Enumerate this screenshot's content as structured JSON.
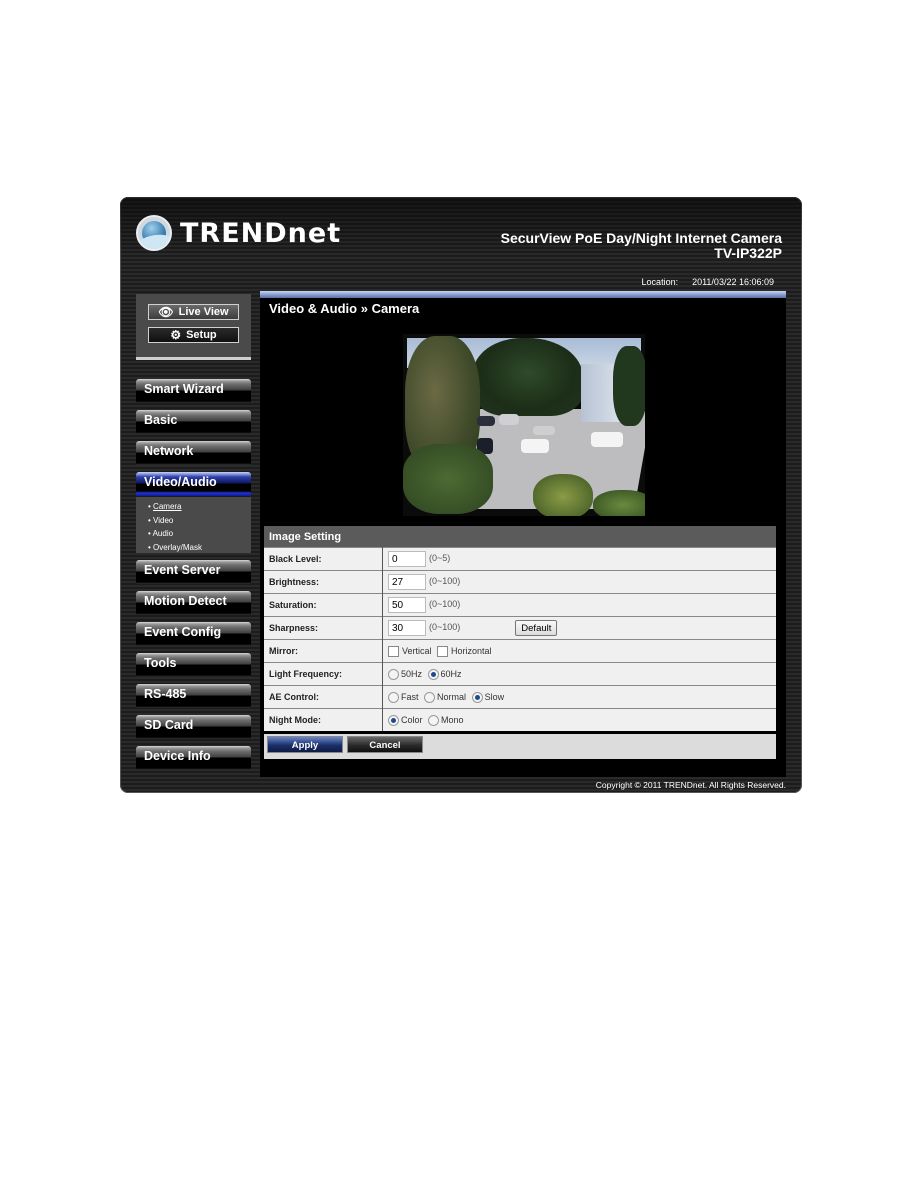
{
  "brand": {
    "logo_text": "TRENDnet"
  },
  "header": {
    "product_name": "SecurView PoE Day/Night Internet Camera",
    "model": "TV-IP322P",
    "location_label": "Location:",
    "datetime": "2011/03/22 16:06:09"
  },
  "mode_buttons": {
    "live_view": "Live View",
    "setup": "Setup"
  },
  "sidebar": {
    "items": [
      {
        "label": "Smart Wizard"
      },
      {
        "label": "Basic"
      },
      {
        "label": "Network"
      },
      {
        "label": "Video/Audio",
        "active": true
      },
      {
        "label": "Event Server"
      },
      {
        "label": "Motion Detect"
      },
      {
        "label": "Event Config"
      },
      {
        "label": "Tools"
      },
      {
        "label": "RS-485"
      },
      {
        "label": "SD Card"
      },
      {
        "label": "Device Info"
      }
    ],
    "submenu": [
      {
        "label": "Camera",
        "selected": true
      },
      {
        "label": "Video"
      },
      {
        "label": "Audio"
      },
      {
        "label": "Overlay/Mask"
      }
    ],
    "bullet": "•"
  },
  "main": {
    "page_title": "Video & Audio » Camera",
    "section_title": "Image Setting",
    "fields": {
      "black_level": {
        "label": "Black Level:",
        "value": "0",
        "range": "(0~5)"
      },
      "brightness": {
        "label": "Brightness:",
        "value": "27",
        "range": "(0~100)"
      },
      "saturation": {
        "label": "Saturation:",
        "value": "50",
        "range": "(0~100)"
      },
      "sharpness": {
        "label": "Sharpness:",
        "value": "30",
        "range": "(0~100)",
        "default_button": "Default"
      },
      "mirror": {
        "label": "Mirror:",
        "options": [
          "Vertical",
          "Horizontal"
        ],
        "checked": []
      },
      "light_frequency": {
        "label": "Light Frequency:",
        "options": [
          "50Hz",
          "60Hz"
        ],
        "selected": "60Hz"
      },
      "ae_control": {
        "label": "AE Control:",
        "options": [
          "Fast",
          "Normal",
          "Slow"
        ],
        "selected": "Slow"
      },
      "night_mode": {
        "label": "Night Mode:",
        "options": [
          "Color",
          "Mono"
        ],
        "selected": "Color"
      }
    },
    "apply_label": "Apply",
    "cancel_label": "Cancel"
  },
  "footer": {
    "copyright": "Copyright © 2011 TRENDnet. All Rights Reserved."
  }
}
